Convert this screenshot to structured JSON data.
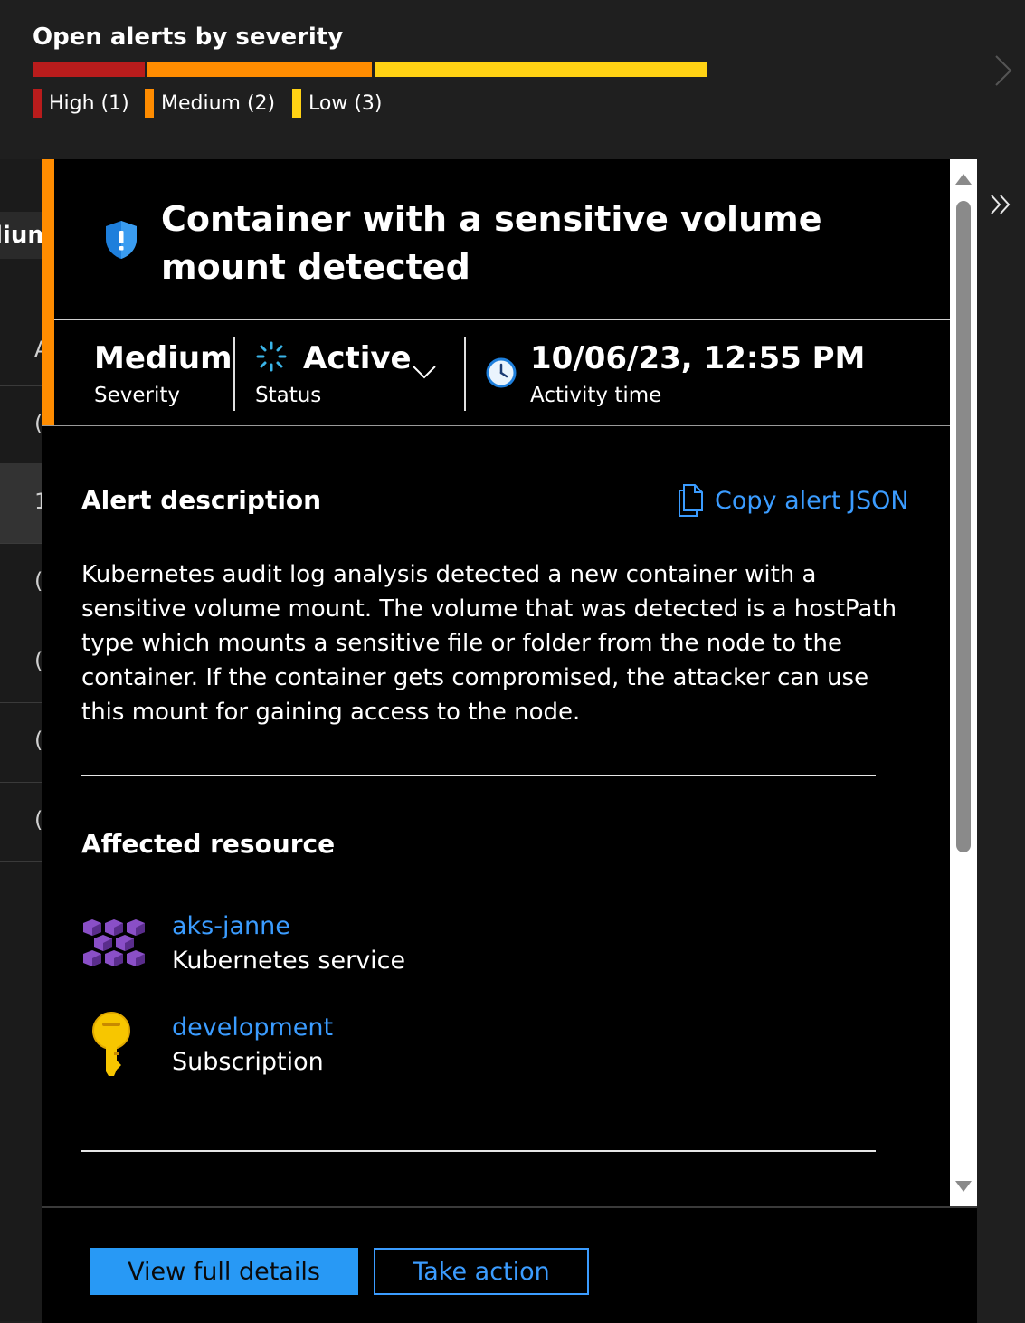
{
  "summary": {
    "title": "Open alerts by severity",
    "legend": [
      {
        "label": "High (1)",
        "count": 1,
        "color": "#b91c1c"
      },
      {
        "label": "Medium (2)",
        "count": 2,
        "color": "#ff8c00"
      },
      {
        "label": "Low (3)",
        "count": 3,
        "color": "#ffd214"
      }
    ]
  },
  "background_list": {
    "header_fragment": "lium",
    "row_fragments": [
      "A",
      "(",
      "1",
      "(",
      "(",
      "(",
      "("
    ]
  },
  "alert": {
    "title": "Container with a sensitive volume mount detected",
    "severity_value": "Medium",
    "severity_label": "Severity",
    "status_value": "Active",
    "status_label": "Status",
    "activity_value": "10/06/23, 12:55 PM",
    "activity_label": "Activity time",
    "accent_color": "#ff8c00"
  },
  "description": {
    "heading": "Alert description",
    "copy_label": "Copy alert JSON",
    "text": "Kubernetes audit log analysis detected a new container with a sensitive volume mount. The volume that was detected is a hostPath type which mounts a sensitive file or folder from the node to the container. If the container gets compromised, the attacker can use this mount for gaining access to the node."
  },
  "affected": {
    "heading": "Affected resource",
    "resources": [
      {
        "name": "aks-janne",
        "type": "Kubernetes service",
        "icon": "kubernetes-service-icon"
      },
      {
        "name": "development",
        "type": "Subscription",
        "icon": "subscription-key-icon"
      }
    ]
  },
  "footer": {
    "primary_label": "View full details",
    "secondary_label": "Take action"
  }
}
